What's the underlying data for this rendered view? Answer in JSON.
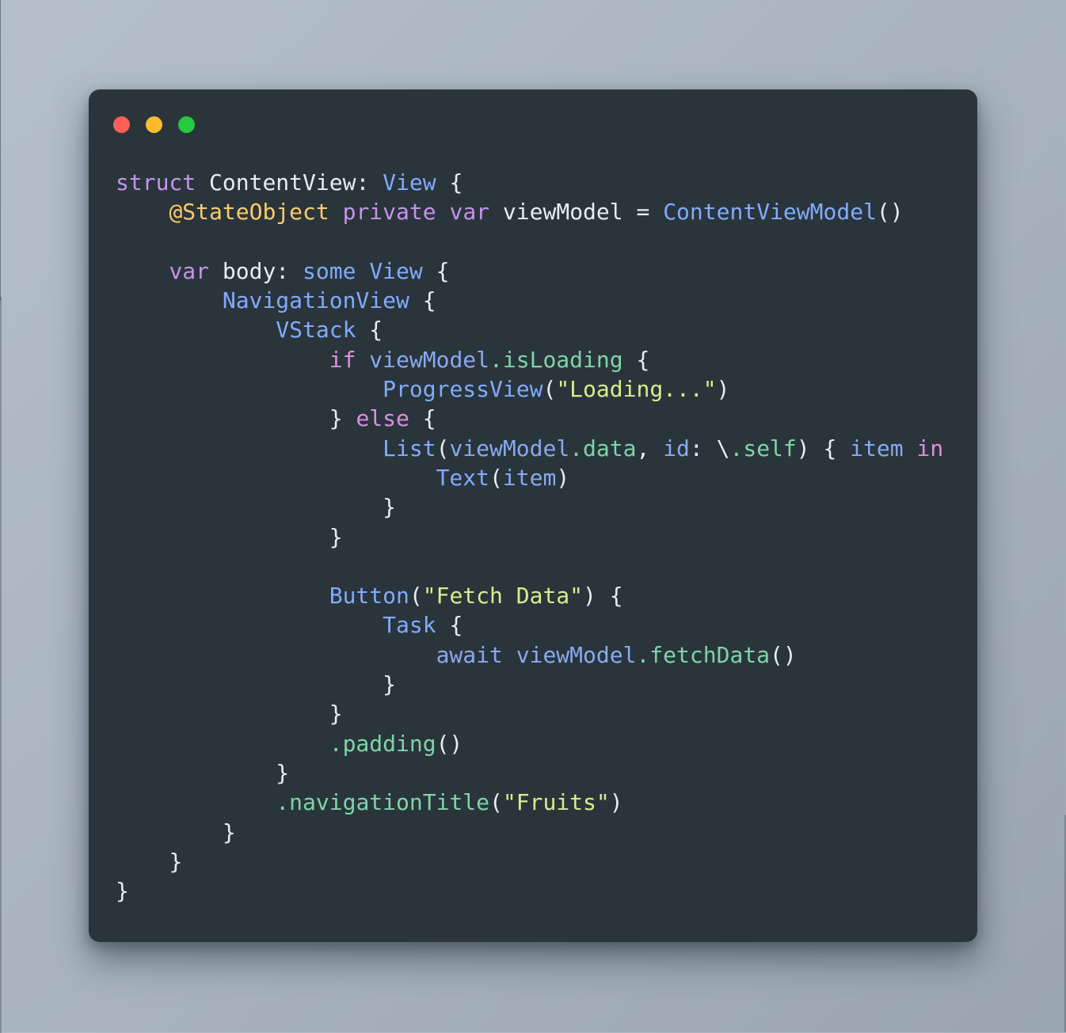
{
  "window": {
    "title": "",
    "traffic_lights": [
      {
        "name": "close",
        "color": "#ff5f56"
      },
      {
        "name": "minimize",
        "color": "#ffbd2e"
      },
      {
        "name": "maximize",
        "color": "#27c93f"
      }
    ]
  },
  "theme": {
    "page_background": "#aab5bf",
    "card_background": "#29353b",
    "default_text": "#e6edf3",
    "keyword": "#c792ea",
    "control_flow": "#dd8ee0",
    "type": "#82aaff",
    "attribute": "#ffcb6b",
    "variable": "#89a9f0",
    "property": "#7fd4a8",
    "string": "#d8ee8c"
  },
  "code": {
    "language": "swift",
    "plain_text": "struct ContentView: View {\n    @StateObject private var viewModel = ContentViewModel()\n\n    var body: some View {\n        NavigationView {\n            VStack {\n                if viewModel.isLoading {\n                    ProgressView(\"Loading...\")\n                } else {\n                    List(viewModel.data, id: \\.self) { item in\n                        Text(item)\n                    }\n                }\n\n                Button(\"Fetch Data\") {\n                    Task {\n                        await viewModel.fetchData()\n                    }\n                }\n                .padding()\n            }\n            .navigationTitle(\"Fruits\")\n        }\n    }\n}",
    "lines": [
      {
        "indent": 0,
        "tokens": [
          {
            "t": "struct",
            "c": "t-kw"
          },
          {
            "t": " ",
            "c": "t-plain"
          },
          {
            "t": "ContentView",
            "c": "t-plain"
          },
          {
            "t": ": ",
            "c": "t-plain"
          },
          {
            "t": "View",
            "c": "t-type"
          },
          {
            "t": " {",
            "c": "t-plain"
          }
        ]
      },
      {
        "indent": 4,
        "tokens": [
          {
            "t": "@StateObject",
            "c": "t-attr"
          },
          {
            "t": " ",
            "c": "t-plain"
          },
          {
            "t": "private",
            "c": "t-kw"
          },
          {
            "t": " ",
            "c": "t-plain"
          },
          {
            "t": "var",
            "c": "t-kw"
          },
          {
            "t": " viewModel = ",
            "c": "t-plain"
          },
          {
            "t": "ContentViewModel",
            "c": "t-type"
          },
          {
            "t": "()",
            "c": "t-plain"
          }
        ]
      },
      {
        "indent": 0,
        "tokens": []
      },
      {
        "indent": 4,
        "tokens": [
          {
            "t": "var",
            "c": "t-kw"
          },
          {
            "t": " body: ",
            "c": "t-plain"
          },
          {
            "t": "some",
            "c": "t-type"
          },
          {
            "t": " ",
            "c": "t-plain"
          },
          {
            "t": "View",
            "c": "t-type"
          },
          {
            "t": " {",
            "c": "t-plain"
          }
        ]
      },
      {
        "indent": 8,
        "tokens": [
          {
            "t": "NavigationView",
            "c": "t-type"
          },
          {
            "t": " {",
            "c": "t-plain"
          }
        ]
      },
      {
        "indent": 12,
        "tokens": [
          {
            "t": "VStack",
            "c": "t-type"
          },
          {
            "t": " {",
            "c": "t-plain"
          }
        ]
      },
      {
        "indent": 16,
        "tokens": [
          {
            "t": "if",
            "c": "t-flow"
          },
          {
            "t": " ",
            "c": "t-plain"
          },
          {
            "t": "viewModel",
            "c": "t-var"
          },
          {
            "t": ".isLoading",
            "c": "t-prop"
          },
          {
            "t": " {",
            "c": "t-plain"
          }
        ]
      },
      {
        "indent": 20,
        "tokens": [
          {
            "t": "ProgressView",
            "c": "t-type"
          },
          {
            "t": "(",
            "c": "t-plain"
          },
          {
            "t": "\"Loading...\"",
            "c": "t-str"
          },
          {
            "t": ")",
            "c": "t-plain"
          }
        ]
      },
      {
        "indent": 16,
        "tokens": [
          {
            "t": "} ",
            "c": "t-plain"
          },
          {
            "t": "else",
            "c": "t-flow"
          },
          {
            "t": " {",
            "c": "t-plain"
          }
        ]
      },
      {
        "indent": 20,
        "tokens": [
          {
            "t": "List",
            "c": "t-type"
          },
          {
            "t": "(",
            "c": "t-plain"
          },
          {
            "t": "viewModel",
            "c": "t-var"
          },
          {
            "t": ".data",
            "c": "t-prop"
          },
          {
            "t": ", ",
            "c": "t-plain"
          },
          {
            "t": "id",
            "c": "t-var"
          },
          {
            "t": ": ",
            "c": "t-plain"
          },
          {
            "t": "\\",
            "c": "t-plain"
          },
          {
            "t": ".self",
            "c": "t-prop"
          },
          {
            "t": ") { ",
            "c": "t-plain"
          },
          {
            "t": "item",
            "c": "t-var"
          },
          {
            "t": " ",
            "c": "t-plain"
          },
          {
            "t": "in",
            "c": "t-flow"
          }
        ]
      },
      {
        "indent": 24,
        "tokens": [
          {
            "t": "Text",
            "c": "t-type"
          },
          {
            "t": "(",
            "c": "t-plain"
          },
          {
            "t": "item",
            "c": "t-var"
          },
          {
            "t": ")",
            "c": "t-plain"
          }
        ]
      },
      {
        "indent": 20,
        "tokens": [
          {
            "t": "}",
            "c": "t-plain"
          }
        ]
      },
      {
        "indent": 16,
        "tokens": [
          {
            "t": "}",
            "c": "t-plain"
          }
        ]
      },
      {
        "indent": 0,
        "tokens": []
      },
      {
        "indent": 16,
        "tokens": [
          {
            "t": "Button",
            "c": "t-type"
          },
          {
            "t": "(",
            "c": "t-plain"
          },
          {
            "t": "\"Fetch Data\"",
            "c": "t-str"
          },
          {
            "t": ") {",
            "c": "t-plain"
          }
        ]
      },
      {
        "indent": 20,
        "tokens": [
          {
            "t": "Task",
            "c": "t-type"
          },
          {
            "t": " {",
            "c": "t-plain"
          }
        ]
      },
      {
        "indent": 24,
        "tokens": [
          {
            "t": "await",
            "c": "t-var"
          },
          {
            "t": " ",
            "c": "t-plain"
          },
          {
            "t": "viewModel",
            "c": "t-var"
          },
          {
            "t": ".fetchData",
            "c": "t-prop"
          },
          {
            "t": "()",
            "c": "t-plain"
          }
        ]
      },
      {
        "indent": 20,
        "tokens": [
          {
            "t": "}",
            "c": "t-plain"
          }
        ]
      },
      {
        "indent": 16,
        "tokens": [
          {
            "t": "}",
            "c": "t-plain"
          }
        ]
      },
      {
        "indent": 16,
        "tokens": [
          {
            "t": ".padding",
            "c": "t-prop"
          },
          {
            "t": "()",
            "c": "t-plain"
          }
        ]
      },
      {
        "indent": 12,
        "tokens": [
          {
            "t": "}",
            "c": "t-plain"
          }
        ]
      },
      {
        "indent": 12,
        "tokens": [
          {
            "t": ".navigationTitle",
            "c": "t-prop"
          },
          {
            "t": "(",
            "c": "t-plain"
          },
          {
            "t": "\"Fruits\"",
            "c": "t-str"
          },
          {
            "t": ")",
            "c": "t-plain"
          }
        ]
      },
      {
        "indent": 8,
        "tokens": [
          {
            "t": "}",
            "c": "t-plain"
          }
        ]
      },
      {
        "indent": 4,
        "tokens": [
          {
            "t": "}",
            "c": "t-plain"
          }
        ]
      },
      {
        "indent": 0,
        "tokens": [
          {
            "t": "}",
            "c": "t-plain"
          }
        ]
      }
    ]
  }
}
